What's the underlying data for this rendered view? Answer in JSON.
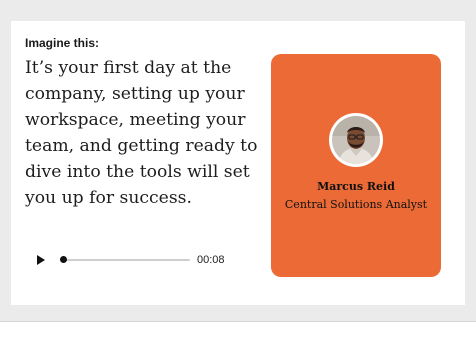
{
  "scenario": {
    "lead": "Imagine this:",
    "body": "It’s your first day at the company, setting up your workspace, meeting your team, and getting ready to dive into the tools will set you up for success."
  },
  "audio_player": {
    "time": "00:08",
    "play_icon": "play-icon",
    "progress": 0.0
  },
  "persona": {
    "name": "Marcus Reid",
    "role": "Central Solutions Analyst",
    "avatar_icon": "person-avatar",
    "card_color": "#ec6a36"
  }
}
